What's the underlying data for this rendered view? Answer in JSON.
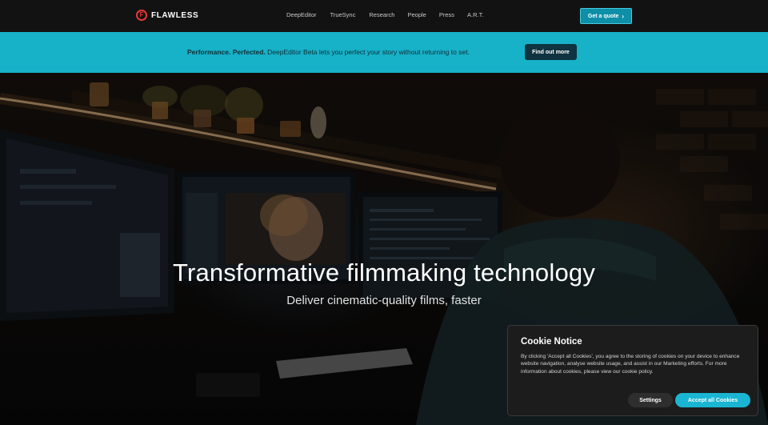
{
  "brand": {
    "name": "FLAWLESS",
    "mark": "F"
  },
  "nav": {
    "links": [
      "DeepEditor",
      "TrueSync",
      "Research",
      "People",
      "Press",
      "A.R.T."
    ],
    "cta": "Get a quote",
    "cta_icon": "chevron-right-icon"
  },
  "banner": {
    "bold": "Performance. Perfected.",
    "text": " DeepEditor Beta lets you perfect your story without returning to set.",
    "button": "Find out more"
  },
  "hero": {
    "title": "Transformative filmmaking technology",
    "subtitle": "Deliver cinematic-quality films, faster"
  },
  "cookie": {
    "title": "Cookie Notice",
    "body": "By clicking 'Accept all Cookies', you agree to the storing of cookies on your device to enhance website navigation, analyse website usage, and assist in our Marketing efforts. For more information about cookies, please view our cookie policy.",
    "settings": "Settings",
    "accept": "Accept all Cookies"
  },
  "colors": {
    "accent": "#17b1c8",
    "brand_red": "#e53935",
    "nav_bg": "#121212"
  }
}
